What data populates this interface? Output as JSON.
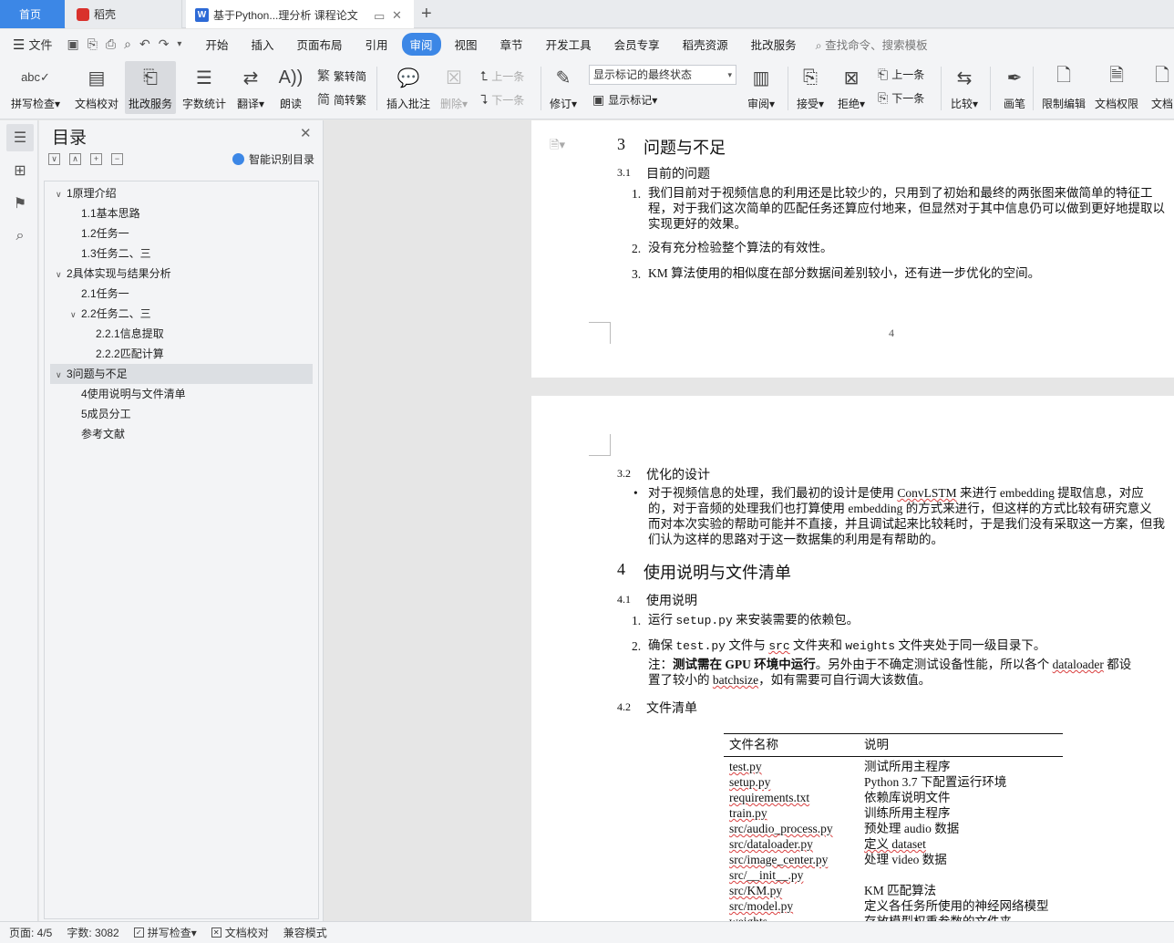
{
  "tabs": {
    "home": "首页",
    "daoke": "稻壳",
    "doc": "基于Python...理分析 课程论文",
    "plus": "+"
  },
  "menu": {
    "file": "文件",
    "tabs": [
      "开始",
      "插入",
      "页面布局",
      "引用",
      "审阅",
      "视图",
      "章节",
      "开发工具",
      "会员专享",
      "稻壳资源",
      "批改服务"
    ],
    "active_tab": "审阅",
    "search_placeholder": "查找命令、搜索模板"
  },
  "ribbon": {
    "spell_check": "拼写检查",
    "doc_proof": "文档校对",
    "correction_service": "批改服务",
    "word_count": "字数统计",
    "translate": "翻译",
    "read_aloud": "朗读",
    "trad_to_simp": "繁转简",
    "simp_to_trad": "简转繁",
    "insert_comment": "插入批注",
    "delete": "删除",
    "prev_comment": "上一条",
    "next_comment": "下一条",
    "track_changes": "修订",
    "markup_state": "显示标记的最终状态",
    "show_markup": "显示标记",
    "review": "审阅",
    "accept": "接受",
    "reject": "拒绝",
    "prev_change": "上一条",
    "next_change": "下一条",
    "compare": "比较",
    "ink": "画笔",
    "restrict_edit": "限制编辑",
    "doc_permission": "文档权限",
    "doc_more": "文档"
  },
  "toc": {
    "title": "目录",
    "ai_label": "智能识别目录",
    "items": [
      {
        "label": "1原理介绍",
        "chev": "∨"
      },
      {
        "label": "1.1基本思路",
        "chev": ""
      },
      {
        "label": "1.2任务一",
        "chev": ""
      },
      {
        "label": "1.3任务二、三",
        "chev": ""
      },
      {
        "label": "2具体实现与结果分析",
        "chev": "∨"
      },
      {
        "label": "2.1任务一",
        "chev": ""
      },
      {
        "label": "2.2任务二、三",
        "chev": "∨"
      },
      {
        "label": "2.2.1信息提取",
        "chev": ""
      },
      {
        "label": "2.2.2匹配计算",
        "chev": ""
      },
      {
        "label": "3问题与不足",
        "chev": "∨"
      },
      {
        "label": "4使用说明与文件清单",
        "chev": ""
      },
      {
        "label": "5成员分工",
        "chev": ""
      },
      {
        "label": "参考文献",
        "chev": ""
      }
    ]
  },
  "page1": {
    "sec3_num": "3",
    "sec3_title": "问题与不足",
    "sec31_num": "3.1",
    "sec31_title": "目前的问题",
    "item1_num": "1.",
    "item1_l1": "我们目前对于视频信息的利用还是比较少的，只用到了初始和最终的两张图来做简单的特征工",
    "item1_l2": "程，对于我们这次简单的匹配任务还算应付地来，但显然对于其中信息仍可以做到更好地提取以",
    "item1_l3": "实现更好的效果。",
    "item2_num": "2.",
    "item2": "没有充分检验整个算法的有效性。",
    "item3_num": "3.",
    "item3": "KM 算法使用的相似度在部分数据间差别较小，还有进一步优化的空间。",
    "page_number": "4"
  },
  "page2": {
    "sec32_num": "3.2",
    "sec32_title": "优化的设计",
    "bullet": "•",
    "opt_l1a": "对于视频信息的处理，我们最初的设计是使用 ",
    "opt_l1b": "ConvLSTM",
    "opt_l1c": " 来进行 embedding 提取信息，对应",
    "opt_l2": "的，对于音频的处理我们也打算使用 embedding 的方式来进行，但这样的方式比较有研究意义",
    "opt_l3": "而对本次实验的帮助可能并不直接，并且调试起来比较耗时，于是我们没有采取这一方案，但我",
    "opt_l4": "们认为这样的思路对于这一数据集的利用是有帮助的。",
    "sec4_num": "4",
    "sec4_title": "使用说明与文件清单",
    "sec41_num": "4.1",
    "sec41_title": "使用说明",
    "u1_num": "1.",
    "u1a": "运行 ",
    "u1b": "setup.py",
    "u1c": " 来安装需要的依赖包。",
    "u2_num": "2.",
    "u2a": "确保 ",
    "u2b": "test.py",
    "u2c": " 文件与 ",
    "u2d": "src",
    "u2e": " 文件夹和 ",
    "u2f": "weights",
    "u2g": " 文件夹处于同一级目录下。",
    "note_l1a": "注：",
    "note_l1b": "测试需在 GPU 环境中运行",
    "note_l1c": "。另外由于不确定测试设备性能，所以各个 ",
    "note_l1d": "dataloader",
    "note_l1e": " 都设",
    "note_l2a": "置了较小的 ",
    "note_l2b": "batchsize",
    "note_l2c": "，如有需要可自行调大该数值。",
    "sec42_num": "4.2",
    "sec42_title": "文件清单",
    "table": {
      "headers": [
        "文件名称",
        "说明"
      ],
      "rows": [
        [
          "test.py",
          "测试所用主程序"
        ],
        [
          "setup.py",
          "Python 3.7 下配置运行环境"
        ],
        [
          "requirements.txt",
          "依赖库说明文件"
        ],
        [
          "train.py",
          "训练所用主程序"
        ],
        [
          "src/audio_process.py",
          "预处理 audio 数据"
        ],
        [
          "src/dataloader.py",
          "定义 dataset"
        ],
        [
          "src/image_center.py",
          "处理 video 数据"
        ],
        [
          "src/__init__.py",
          ""
        ],
        [
          "src/KM.py",
          "KM 匹配算法"
        ],
        [
          "src/model.py",
          "定义各任务所使用的神经网络模型"
        ],
        [
          "weights",
          "存放模型权重参数的文件夹"
        ]
      ]
    }
  },
  "status": {
    "page": "页面: 4/5",
    "words": "字数: 3082",
    "spell": "拼写检查",
    "proof": "文档校对",
    "compat": "兼容模式"
  }
}
